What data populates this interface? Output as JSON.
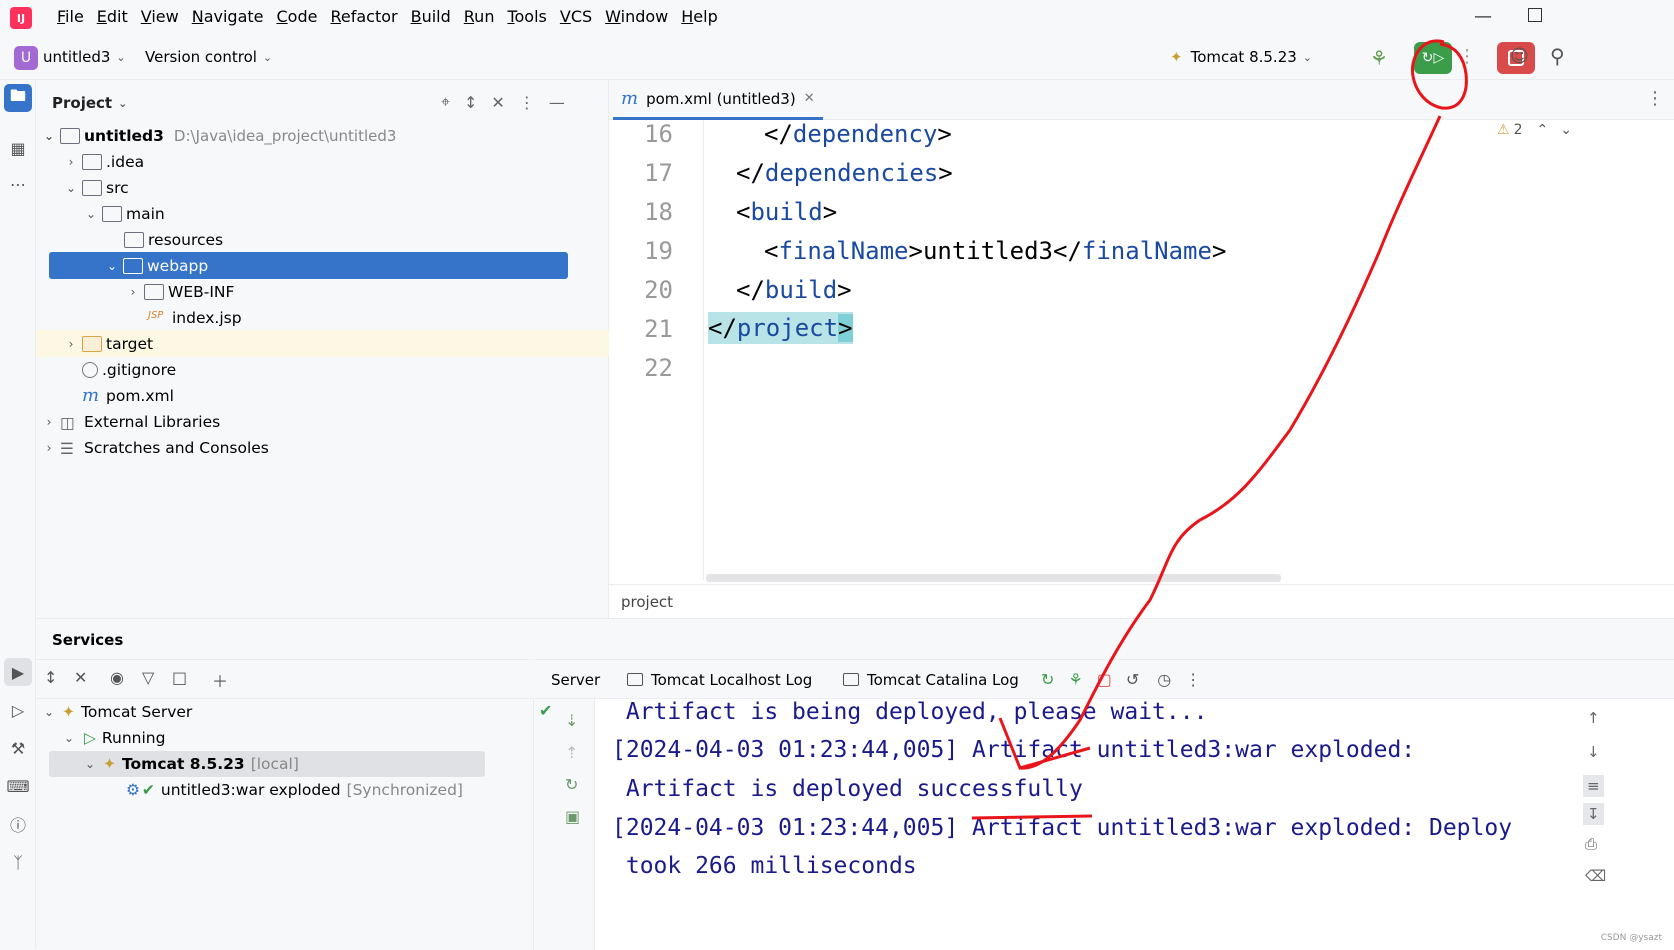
{
  "menubar": {
    "items": [
      "File",
      "Edit",
      "View",
      "Navigate",
      "Code",
      "Refactor",
      "Build",
      "Run",
      "Tools",
      "VCS",
      "Window",
      "Help"
    ]
  },
  "toolbar": {
    "project_badge": "U",
    "project_name": "untitled3",
    "version_control": "Version control",
    "run_config": "Tomcat 8.5.23"
  },
  "project_panel": {
    "title": "Project",
    "tree": [
      {
        "label": "untitled3",
        "path": "D:\\Java\\idea_project\\untitled3"
      },
      {
        "label": ".idea"
      },
      {
        "label": "src"
      },
      {
        "label": "main"
      },
      {
        "label": "resources"
      },
      {
        "label": "webapp"
      },
      {
        "label": "WEB-INF"
      },
      {
        "label": "index.jsp"
      },
      {
        "label": "target"
      },
      {
        "label": ".gitignore"
      },
      {
        "label": "pom.xml"
      },
      {
        "label": "External Libraries"
      },
      {
        "label": "Scratches and Consoles"
      }
    ]
  },
  "editor": {
    "tab_label": "pom.xml (untitled3)",
    "tab_icon": "m",
    "warning_count": "2",
    "line_numbers": [
      "16",
      "17",
      "18",
      "19",
      "20",
      "21",
      "22"
    ],
    "lines": [
      {
        "open": "</",
        "tag": "dependency",
        "close": ">"
      },
      {
        "open": "</",
        "tag": "dependencies",
        "close": ">"
      },
      {
        "open": "<",
        "tag": "build",
        "close": ">"
      },
      {
        "open": "<",
        "tag": "finalName",
        "mid": ">untitled3</",
        "tag2": "finalName",
        "close": ">"
      },
      {
        "open": "</",
        "tag": "build",
        "close": ">"
      },
      {
        "open": "</",
        "tag": "project",
        "close": ">"
      }
    ],
    "breadcrumb": "project"
  },
  "services": {
    "title": "Services",
    "tree": {
      "server": "Tomcat Server",
      "status": "Running",
      "instance": "Tomcat 8.5.23",
      "instance_tag": "[local]",
      "artifact": "untitled3:war exploded",
      "artifact_tag": "[Synchronized]"
    },
    "tabs": [
      "Server",
      "Tomcat Localhost Log",
      "Tomcat Catalina Log"
    ],
    "console": [
      " Artifact is being deployed, please wait...",
      "[2024-04-03 01:23:44,005] Artifact untitled3:war exploded:",
      " Artifact is deployed successfully",
      "[2024-04-03 01:23:44,005] Artifact untitled3:war exploded: Deploy",
      " took 266 milliseconds"
    ]
  },
  "watermark": "CSDN @ysazt",
  "colors": {
    "accent": "#3574c9",
    "run_green": "#3b9c4a",
    "stop_red": "#d94a4a",
    "annotation_red": "#e8161b"
  }
}
